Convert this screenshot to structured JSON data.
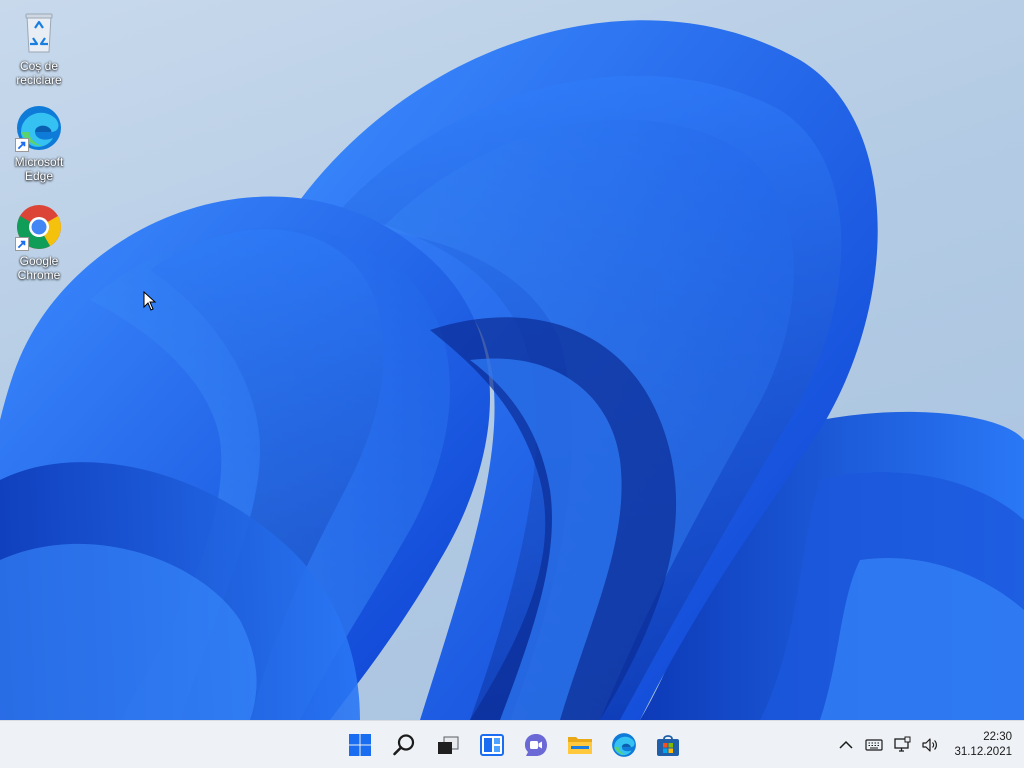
{
  "desktop": {
    "icons": [
      {
        "label": "Coș de\nreciclare",
        "icon": "recycle-bin-icon"
      },
      {
        "label": "Microsoft\nEdge",
        "icon": "edge-icon"
      },
      {
        "label": "Google\nChrome",
        "icon": "chrome-icon"
      }
    ]
  },
  "taskbar": {
    "apps": [
      {
        "name": "start",
        "icon": "windows-logo-icon"
      },
      {
        "name": "search",
        "icon": "search-icon"
      },
      {
        "name": "task-view",
        "icon": "task-view-icon"
      },
      {
        "name": "widgets",
        "icon": "widgets-icon"
      },
      {
        "name": "chat",
        "icon": "teams-chat-icon"
      },
      {
        "name": "file-explorer",
        "icon": "folder-icon"
      },
      {
        "name": "edge",
        "icon": "edge-icon"
      },
      {
        "name": "store",
        "icon": "store-icon"
      }
    ],
    "tray": {
      "icons": [
        "chevron-up-icon",
        "keyboard-icon",
        "network-icon",
        "volume-icon"
      ],
      "time": "22:30",
      "date": "31.12.2021"
    }
  },
  "colors": {
    "accent": "#1a6cf0",
    "wallpaper_bg": "#b3cbe4",
    "taskbar_bg": "#eef1f5"
  }
}
